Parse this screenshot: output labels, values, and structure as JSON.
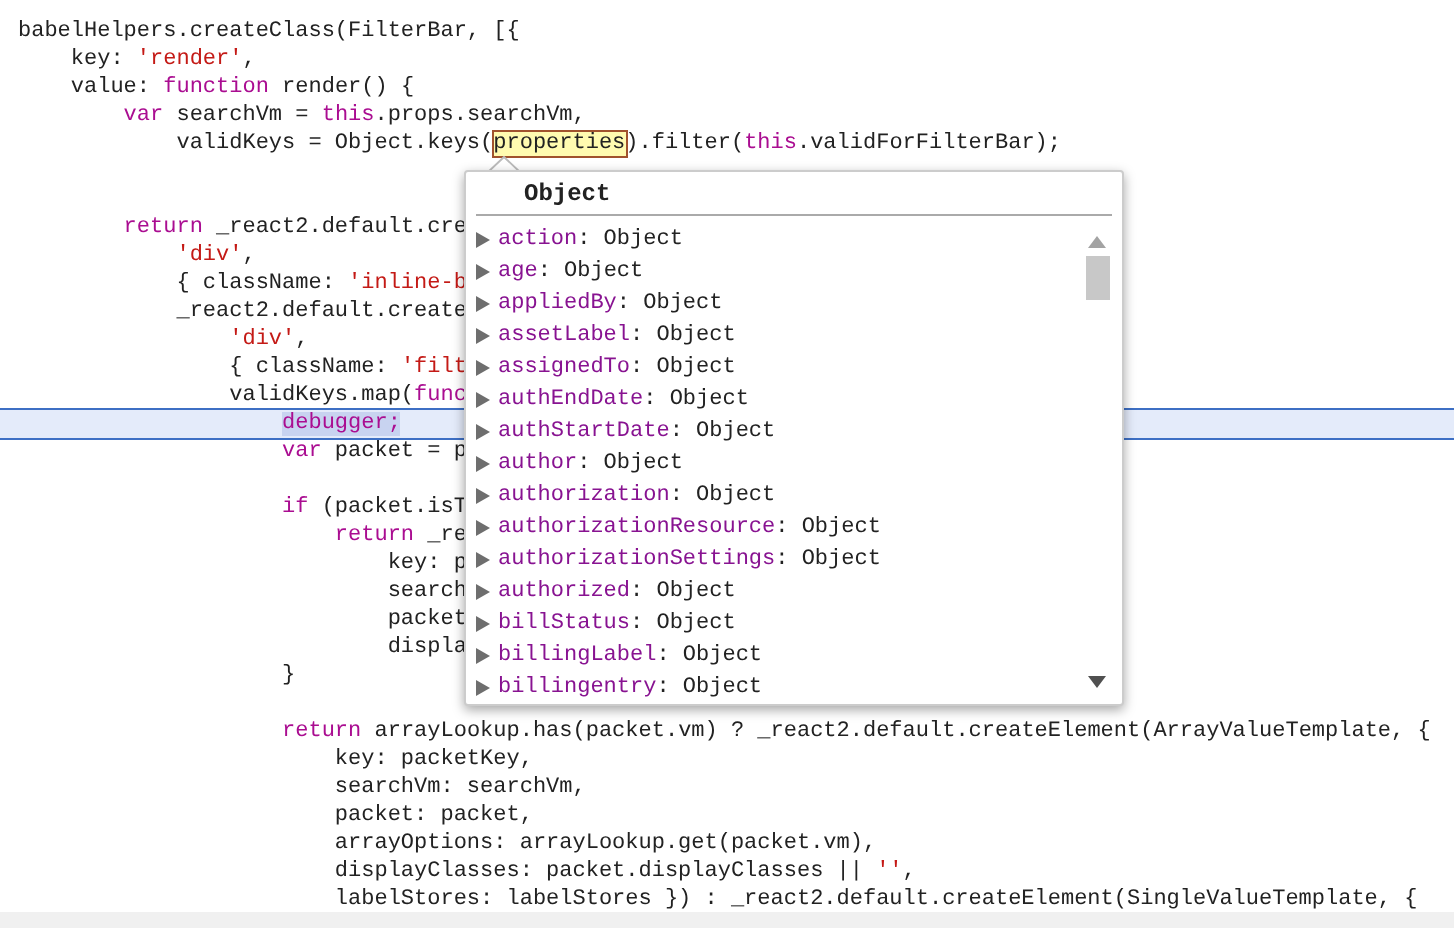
{
  "code_lines": [
    {
      "paused": false,
      "tokens": [
        {
          "kind": "plain",
          "text": "babelHelpers.createClass(FilterBar, [{"
        }
      ]
    },
    {
      "paused": false,
      "tokens": [
        {
          "kind": "plain",
          "text": "    key: "
        },
        {
          "kind": "string",
          "text": "'render'"
        },
        {
          "kind": "plain",
          "text": ","
        }
      ]
    },
    {
      "paused": false,
      "tokens": [
        {
          "kind": "plain",
          "text": "    value: "
        },
        {
          "kind": "keyword",
          "text": "function"
        },
        {
          "kind": "plain",
          "text": " render() {"
        }
      ]
    },
    {
      "paused": false,
      "tokens": [
        {
          "kind": "keyword",
          "text": "        var"
        },
        {
          "kind": "plain",
          "text": " searchVm = "
        },
        {
          "kind": "keyword",
          "text": "this"
        },
        {
          "kind": "plain",
          "text": ".props.searchVm,"
        }
      ]
    },
    {
      "paused": false,
      "tokens": [
        {
          "kind": "plain",
          "text": "            validKeys = Object.keys("
        },
        {
          "kind": "hovered",
          "text": "properties"
        },
        {
          "kind": "plain",
          "text": ").filter("
        },
        {
          "kind": "keyword",
          "text": "this"
        },
        {
          "kind": "plain",
          "text": ".validForFilterBar);"
        }
      ]
    },
    {
      "paused": false
    },
    {
      "paused": false
    },
    {
      "paused": false,
      "tokens": [
        {
          "kind": "keyword",
          "text": "        return"
        },
        {
          "kind": "plain",
          "text": " _react2.default.cre"
        }
      ]
    },
    {
      "paused": false,
      "tokens": [
        {
          "kind": "string",
          "text": "            'div'"
        },
        {
          "kind": "plain",
          "text": ","
        }
      ]
    },
    {
      "paused": false,
      "tokens": [
        {
          "kind": "plain",
          "text": "            { className: "
        },
        {
          "kind": "string",
          "text": "'inline-b"
        }
      ]
    },
    {
      "paused": false,
      "tokens": [
        {
          "kind": "plain",
          "text": "            _react2.default.create"
        }
      ]
    },
    {
      "paused": false,
      "tokens": [
        {
          "kind": "string",
          "text": "                'div'"
        },
        {
          "kind": "plain",
          "text": ","
        }
      ]
    },
    {
      "paused": false,
      "tokens": [
        {
          "kind": "plain",
          "text": "                { className: "
        },
        {
          "kind": "string",
          "text": "'filt"
        }
      ]
    },
    {
      "paused": false,
      "tokens": [
        {
          "kind": "plain",
          "text": "                validKeys.map("
        },
        {
          "kind": "keyword",
          "text": "func"
        }
      ]
    },
    {
      "paused": true,
      "tokens": [
        {
          "kind": "executing",
          "text": "                    debugger;"
        }
      ]
    },
    {
      "paused": false,
      "tokens": [
        {
          "kind": "keyword",
          "text": "                    var"
        },
        {
          "kind": "plain",
          "text": " packet = p"
        }
      ]
    },
    {
      "paused": false
    },
    {
      "paused": false,
      "tokens": [
        {
          "kind": "keyword",
          "text": "                    if"
        },
        {
          "kind": "plain",
          "text": " (packet.isT"
        }
      ]
    },
    {
      "paused": false,
      "tokens": [
        {
          "kind": "keyword",
          "text": "                        return"
        },
        {
          "kind": "plain",
          "text": " _re"
        }
      ]
    },
    {
      "paused": false,
      "tokens": [
        {
          "kind": "plain",
          "text": "                            key: p"
        }
      ]
    },
    {
      "paused": false,
      "tokens": [
        {
          "kind": "plain",
          "text": "                            search"
        }
      ]
    },
    {
      "paused": false,
      "tokens": [
        {
          "kind": "plain",
          "text": "                            packet"
        }
      ]
    },
    {
      "paused": false,
      "tokens": [
        {
          "kind": "plain",
          "text": "                            displa"
        }
      ]
    },
    {
      "paused": false,
      "tokens": [
        {
          "kind": "plain",
          "text": "                    }"
        }
      ]
    },
    {
      "paused": false
    },
    {
      "paused": false,
      "tokens": [
        {
          "kind": "keyword",
          "text": "                    return"
        },
        {
          "kind": "plain",
          "text": " arrayLookup.has(packet.vm) ? _react2.default.createElement(ArrayValueTemplate, {"
        }
      ]
    },
    {
      "paused": false,
      "tokens": [
        {
          "kind": "plain",
          "text": "                        key: packetKey,"
        }
      ]
    },
    {
      "paused": false,
      "tokens": [
        {
          "kind": "plain",
          "text": "                        searchVm: searchVm,"
        }
      ]
    },
    {
      "paused": false,
      "tokens": [
        {
          "kind": "plain",
          "text": "                        packet: packet,"
        }
      ]
    },
    {
      "paused": false,
      "tokens": [
        {
          "kind": "plain",
          "text": "                        arrayOptions: arrayLookup.get(packet.vm),"
        }
      ]
    },
    {
      "paused": false,
      "tokens": [
        {
          "kind": "plain",
          "text": "                        displayClasses: packet.displayClasses || "
        },
        {
          "kind": "string",
          "text": "''"
        },
        {
          "kind": "plain",
          "text": ","
        }
      ]
    },
    {
      "paused": false,
      "tokens": [
        {
          "kind": "plain",
          "text": "                        labelStores: labelStores }) : _react2.default.createElement(SingleValueTemplate, {"
        }
      ]
    }
  ],
  "popover": {
    "title": "Object",
    "properties": [
      {
        "key": "action",
        "value": ": Object",
        "expanded": false
      },
      {
        "key": "age",
        "value": ": Object",
        "expanded": false
      },
      {
        "key": "appliedBy",
        "value": ": Object",
        "expanded": false
      },
      {
        "key": "assetLabel",
        "value": ": Object",
        "expanded": false
      },
      {
        "key": "assignedTo",
        "value": ": Object",
        "expanded": false
      },
      {
        "key": "authEndDate",
        "value": ": Object",
        "expanded": false
      },
      {
        "key": "authStartDate",
        "value": ": Object",
        "expanded": false
      },
      {
        "key": "author",
        "value": ": Object",
        "expanded": false
      },
      {
        "key": "authorization",
        "value": ": Object",
        "expanded": false
      },
      {
        "key": "authorizationResource",
        "value": ": Object",
        "expanded": false
      },
      {
        "key": "authorizationSettings",
        "value": ": Object",
        "expanded": false
      },
      {
        "key": "authorized",
        "value": ": Object",
        "expanded": false
      },
      {
        "key": "billStatus",
        "value": ": Object",
        "expanded": false
      },
      {
        "key": "billingLabel",
        "value": ": Object",
        "expanded": false
      },
      {
        "key": "billingentry",
        "value": ": Object",
        "expanded": false
      }
    ]
  }
}
